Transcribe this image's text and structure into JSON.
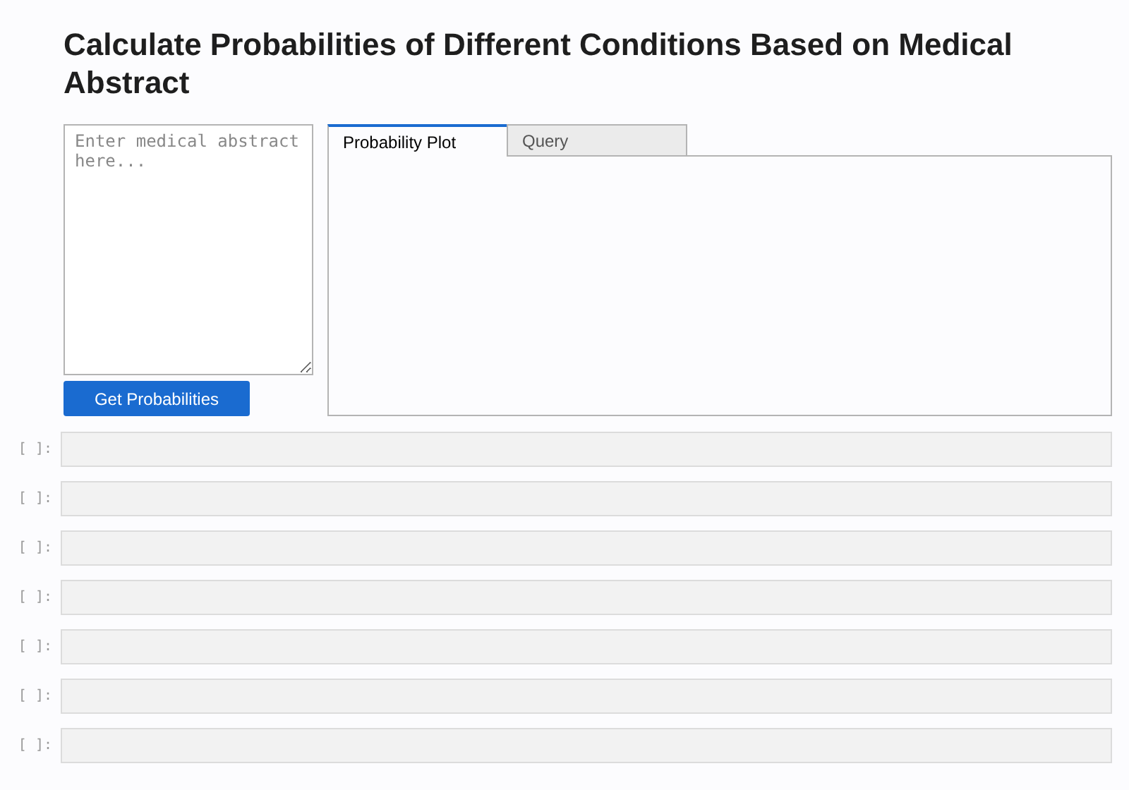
{
  "title": "Calculate Probabilities of Different Conditions Based on Medical Abstract",
  "abstract_field": {
    "placeholder": "Enter medical abstract here..."
  },
  "button": "Get Probabilities",
  "tabs": [
    {
      "label": "Probability Plot",
      "selected": true
    },
    {
      "label": "Query",
      "selected": false
    }
  ],
  "cells": [
    {
      "prompt": "[ ]:"
    },
    {
      "prompt": "[ ]:"
    },
    {
      "prompt": "[ ]:"
    },
    {
      "prompt": "[ ]:"
    },
    {
      "prompt": "[ ]:"
    },
    {
      "prompt": "[ ]:"
    },
    {
      "prompt": "[ ]:"
    }
  ]
}
